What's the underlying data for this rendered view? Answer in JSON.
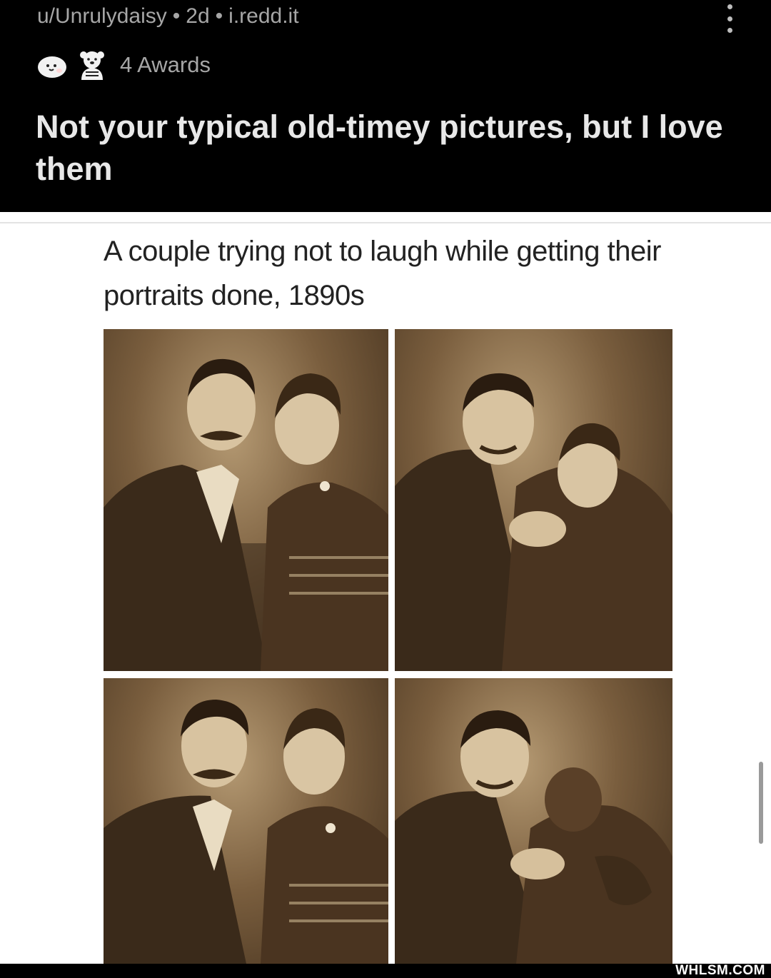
{
  "post": {
    "author": "u/Unrulydaisy",
    "age": "2d",
    "domain": "i.redd.it",
    "separator": "•",
    "awards_label": "4 Awards",
    "title": "Not your typical old-timey pictures, but I love them",
    "award_icons": [
      "wholesome-seal-icon",
      "wholesome-bear-icon"
    ],
    "menu_icon": "kebab-menu-icon"
  },
  "image": {
    "caption": "A couple trying not to laugh while getting their portraits done, 1890s",
    "photos": [
      {
        "description_icon": "portrait-couple-posed"
      },
      {
        "description_icon": "portrait-couple-laughing"
      },
      {
        "description_icon": "portrait-couple-posed"
      },
      {
        "description_icon": "portrait-couple-laughing"
      }
    ]
  },
  "watermark": "WHLSM.COM",
  "colors": {
    "background": "#000000",
    "meta_text": "#a6a6a6",
    "title_text": "#e8e8e8",
    "sepia_dark": "#3e2c1a",
    "sepia_light": "#b59a73"
  }
}
